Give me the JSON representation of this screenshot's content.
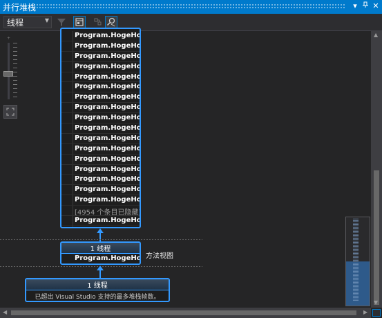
{
  "window": {
    "title": "并行堆栈"
  },
  "toolbar": {
    "view_select": {
      "value": "线程"
    }
  },
  "icons": {
    "window_position": "dropdown-icon",
    "pin": "pin-icon",
    "close": "close-icon",
    "filter": "filter-icon",
    "toggle_method_view": "method-view-icon",
    "auto_scroll": "auto-scroll-icon",
    "zoom_individual": "zoom-find-icon"
  },
  "stack_frames": {
    "top_frame": {
      "rows": [
        "Program.HogeHoge",
        "Program.HogeHoge",
        "Program.HogeHoge",
        "Program.HogeHoge",
        "Program.HogeHoge",
        "Program.HogeHoge",
        "Program.HogeHoge",
        "Program.HogeHoge",
        "Program.HogeHoge",
        "Program.HogeHoge",
        "Program.HogeHoge",
        "Program.HogeHoge",
        "Program.HogeHoge",
        "Program.HogeHoge",
        "Program.HogeHoge",
        "Program.HogeHoge",
        "Program.HogeHoge",
        "[4954 个条目已隐藏]",
        "Program.HogeHoge",
        "Program.HogeHoge"
      ]
    },
    "middle_frame": {
      "header": "1 线程",
      "rows": [
        "Program.HogeHoge"
      ]
    },
    "bottom_frame": {
      "header": "1 线程",
      "note": "已超出 Visual Studio 支持的最多堆栈帧数。"
    },
    "method_view_label": "方法视图"
  },
  "colors": {
    "accent": "#007acc",
    "frame_border": "#3399ff",
    "background": "#252526"
  }
}
